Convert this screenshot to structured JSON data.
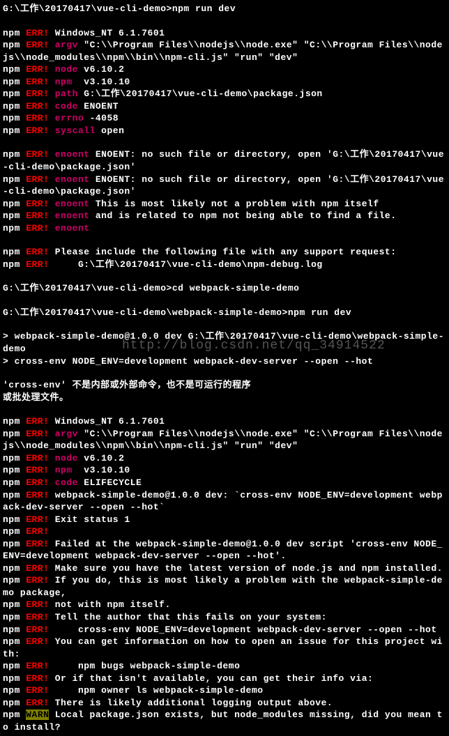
{
  "watermark": "http://blog.csdn.net/qq_34914522",
  "lines": [
    {
      "type": "plain",
      "text": "G:\\工作\\20170417\\vue-cli-demo>npm run dev"
    },
    {
      "type": "empty"
    },
    {
      "type": "npm-err",
      "text": " Windows_NT 6.1.7601"
    },
    {
      "type": "npm-err-label",
      "label": "argv",
      "text": " \"C:\\\\Program Files\\\\nodejs\\\\node.exe\" \"C:\\\\Program Files\\\\nodejs\\\\node_modules\\\\npm\\\\bin\\\\npm-cli.js\" \"run\" \"dev\""
    },
    {
      "type": "npm-err-label",
      "label": "node",
      "text": " v6.10.2"
    },
    {
      "type": "npm-err-label",
      "label": "npm ",
      "text": " v3.10.10"
    },
    {
      "type": "npm-err-label",
      "label": "path",
      "text": " G:\\工作\\20170417\\vue-cli-demo\\package.json"
    },
    {
      "type": "npm-err-label",
      "label": "code",
      "text": " ENOENT"
    },
    {
      "type": "npm-err-label",
      "label": "errno",
      "text": " -4058"
    },
    {
      "type": "npm-err-label",
      "label": "syscall",
      "text": " open"
    },
    {
      "type": "empty"
    },
    {
      "type": "npm-err-label",
      "label": "enoent",
      "text": " ENOENT: no such file or directory, open 'G:\\工作\\20170417\\vue-cli-demo\\package.json'"
    },
    {
      "type": "npm-err-label",
      "label": "enoent",
      "text": " ENOENT: no such file or directory, open 'G:\\工作\\20170417\\vue-cli-demo\\package.json'"
    },
    {
      "type": "npm-err-label",
      "label": "enoent",
      "text": " This is most likely not a problem with npm itself"
    },
    {
      "type": "npm-err-label",
      "label": "enoent",
      "text": " and is related to npm not being able to find a file."
    },
    {
      "type": "npm-err-label",
      "label": "enoent",
      "text": ""
    },
    {
      "type": "empty"
    },
    {
      "type": "npm-err",
      "text": " Please include the following file with any support request:"
    },
    {
      "type": "npm-err",
      "text": "     G:\\工作\\20170417\\vue-cli-demo\\npm-debug.log"
    },
    {
      "type": "empty"
    },
    {
      "type": "plain",
      "text": "G:\\工作\\20170417\\vue-cli-demo>cd webpack-simple-demo"
    },
    {
      "type": "empty"
    },
    {
      "type": "plain",
      "text": "G:\\工作\\20170417\\vue-cli-demo\\webpack-simple-demo>npm run dev"
    },
    {
      "type": "empty"
    },
    {
      "type": "plain",
      "text": "> webpack-simple-demo@1.0.0 dev G:\\工作\\20170417\\vue-cli-demo\\webpack-simple-demo"
    },
    {
      "type": "plain",
      "text": "> cross-env NODE_ENV=development webpack-dev-server --open --hot"
    },
    {
      "type": "empty"
    },
    {
      "type": "plain",
      "text": "'cross-env' 不是内部或外部命令，也不是可运行的程序"
    },
    {
      "type": "plain",
      "text": "或批处理文件。"
    },
    {
      "type": "empty"
    },
    {
      "type": "npm-err",
      "text": " Windows_NT 6.1.7601"
    },
    {
      "type": "npm-err-label",
      "label": "argv",
      "text": " \"C:\\\\Program Files\\\\nodejs\\\\node.exe\" \"C:\\\\Program Files\\\\nodejs\\\\node_modules\\\\npm\\\\bin\\\\npm-cli.js\" \"run\" \"dev\""
    },
    {
      "type": "npm-err-label",
      "label": "node",
      "text": " v6.10.2"
    },
    {
      "type": "npm-err-label",
      "label": "npm ",
      "text": " v3.10.10"
    },
    {
      "type": "npm-err-label",
      "label": "code",
      "text": " ELIFECYCLE"
    },
    {
      "type": "npm-err",
      "text": " webpack-simple-demo@1.0.0 dev: `cross-env NODE_ENV=development webpack-dev-server --open --hot`"
    },
    {
      "type": "npm-err",
      "text": " Exit status 1"
    },
    {
      "type": "npm-err",
      "text": ""
    },
    {
      "type": "npm-err",
      "text": " Failed at the webpack-simple-demo@1.0.0 dev script 'cross-env NODE_ENV=development webpack-dev-server --open --hot'."
    },
    {
      "type": "npm-err",
      "text": " Make sure you have the latest version of node.js and npm installed."
    },
    {
      "type": "npm-err",
      "text": " If you do, this is most likely a problem with the webpack-simple-demo package,"
    },
    {
      "type": "npm-err",
      "text": " not with npm itself."
    },
    {
      "type": "npm-err",
      "text": " Tell the author that this fails on your system:"
    },
    {
      "type": "npm-err",
      "text": "     cross-env NODE_ENV=development webpack-dev-server --open --hot"
    },
    {
      "type": "npm-err",
      "text": " You can get information on how to open an issue for this project with:"
    },
    {
      "type": "npm-err",
      "text": "     npm bugs webpack-simple-demo"
    },
    {
      "type": "npm-err",
      "text": " Or if that isn't available, you can get their info via:"
    },
    {
      "type": "npm-err",
      "text": "     npm owner ls webpack-simple-demo"
    },
    {
      "type": "npm-err",
      "text": " There is likely additional logging output above."
    },
    {
      "type": "npm-warn",
      "text": " Local package.json exists, but node_modules missing, did you mean to install?"
    }
  ]
}
